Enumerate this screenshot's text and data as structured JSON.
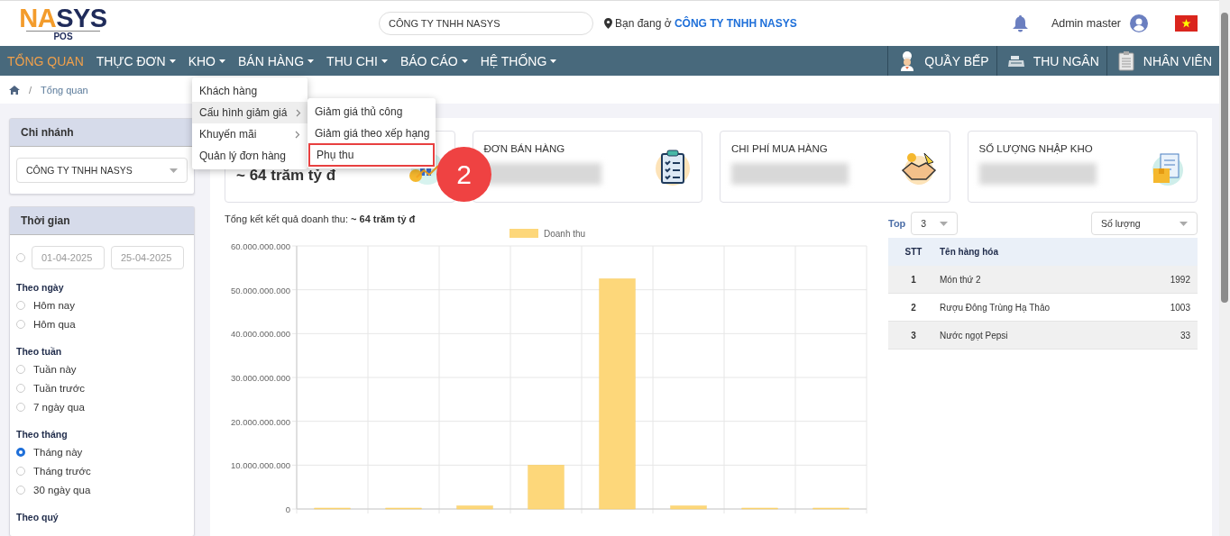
{
  "header": {
    "logo": {
      "text": "NASYS",
      "sub": "POS"
    },
    "branch_search": {
      "value": "CÔNG TY TNHH NASYS"
    },
    "location": {
      "prefix": "Bạn đang ở",
      "company": "CÔNG TY TNHH NASYS"
    },
    "user": "Admin master"
  },
  "nav": {
    "items": [
      {
        "label": "TỔNG QUAN",
        "selected": true,
        "has_menu": false
      },
      {
        "label": "THỰC ĐƠN",
        "selected": false,
        "has_menu": true
      },
      {
        "label": "KHO",
        "selected": false,
        "has_menu": true
      },
      {
        "label": "BÁN HÀNG",
        "selected": false,
        "has_menu": true
      },
      {
        "label": "THU CHI",
        "selected": false,
        "has_menu": true
      },
      {
        "label": "BÁO CÁO",
        "selected": false,
        "has_menu": true
      },
      {
        "label": "HỆ THỐNG",
        "selected": false,
        "has_menu": true
      }
    ],
    "right_items": [
      {
        "label": "QUẦY BẾP",
        "kind": "chef"
      },
      {
        "label": "THU NGÂN",
        "kind": "register"
      },
      {
        "label": "NHÂN VIÊN",
        "kind": "clipboard"
      }
    ]
  },
  "breadcrumb": {
    "separator": "/",
    "current": "Tổng quan"
  },
  "dropdown": {
    "items": [
      {
        "label": "Khách hàng",
        "selected": false,
        "submenu": false
      },
      {
        "label": "Cấu hình giảm giá",
        "selected": true,
        "submenu": true
      },
      {
        "label": "Khuyến mãi",
        "selected": false,
        "submenu": true
      },
      {
        "label": "Quản lý đơn hàng",
        "selected": false,
        "submenu": false
      }
    ],
    "submenu": [
      {
        "label": "Giảm giá thủ công",
        "outlined": false
      },
      {
        "label": "Giảm giá theo xếp hạng",
        "outlined": false
      },
      {
        "label": "Phụ thu",
        "outlined": true
      }
    ]
  },
  "callout": "2",
  "sidebar": {
    "branch": {
      "title": "Chi nhánh",
      "value": "CÔNG TY TNHH NASYS"
    },
    "time": {
      "title": "Thời gian",
      "custom": {
        "selected": false,
        "from": "01-04-2025",
        "to": "25-04-2025"
      },
      "groups": [
        {
          "label": "Theo ngày",
          "options": [
            {
              "label": "Hôm nay",
              "selected": false
            },
            {
              "label": "Hôm qua",
              "selected": false
            }
          ]
        },
        {
          "label": "Theo tuần",
          "options": [
            {
              "label": "Tuần này",
              "selected": false
            },
            {
              "label": "Tuần trước",
              "selected": false
            },
            {
              "label": "7 ngày qua",
              "selected": false
            }
          ]
        },
        {
          "label": "Theo tháng",
          "options": [
            {
              "label": "Tháng này",
              "selected": true
            },
            {
              "label": "Tháng trước",
              "selected": false
            },
            {
              "label": "30 ngày qua",
              "selected": false
            }
          ]
        },
        {
          "label": "Theo quý"
        }
      ]
    }
  },
  "stat_cards": [
    {
      "kind": "revenue",
      "value": "~ 64 trăm tỷ đ"
    },
    {
      "kind": "orders",
      "title": "ĐƠN BÁN HÀNG"
    },
    {
      "kind": "purchase",
      "title": "CHI PHÍ MUA HÀNG"
    },
    {
      "kind": "stock",
      "title": "SỐ LƯỢNG NHẬP KHO"
    }
  ],
  "revenue": {
    "label": "Tổng kết kết quả doanh thu:",
    "value": "~ 64 trăm tỷ đ",
    "chart_data": {
      "type": "bar",
      "grid": true,
      "ylim": [
        0,
        60000000000
      ],
      "yticks": [
        {
          "value": 0,
          "label": "0"
        },
        {
          "value": 10000000000,
          "label": "10.000.000.000"
        },
        {
          "value": 20000000000,
          "label": "20.000.000.000"
        },
        {
          "value": 30000000000,
          "label": "30.000.000.000"
        },
        {
          "value": 40000000000,
          "label": "40.000.000.000"
        },
        {
          "value": 50000000000,
          "label": "50.000.000.000"
        },
        {
          "value": 60000000000,
          "label": "60.000.000.000"
        }
      ],
      "series": [
        {
          "name": "Doanh thu",
          "color": "#fdd77a",
          "values": [
            0,
            0,
            700000000,
            10000000000,
            52500000000,
            700000000,
            0,
            0
          ]
        }
      ]
    }
  },
  "top": {
    "label": "Top",
    "count": "3",
    "metric": "Số lượng",
    "columns": [
      "STT",
      "Tên hàng hóa"
    ],
    "rows": [
      {
        "stt": "1",
        "name": "Món thứ 2",
        "value": "1992"
      },
      {
        "stt": "2",
        "name": "Rượu Đông Trùng Hạ Thảo",
        "value": "1003"
      },
      {
        "stt": "3",
        "name": "Nước ngọt Pepsi",
        "value": "33"
      }
    ]
  }
}
